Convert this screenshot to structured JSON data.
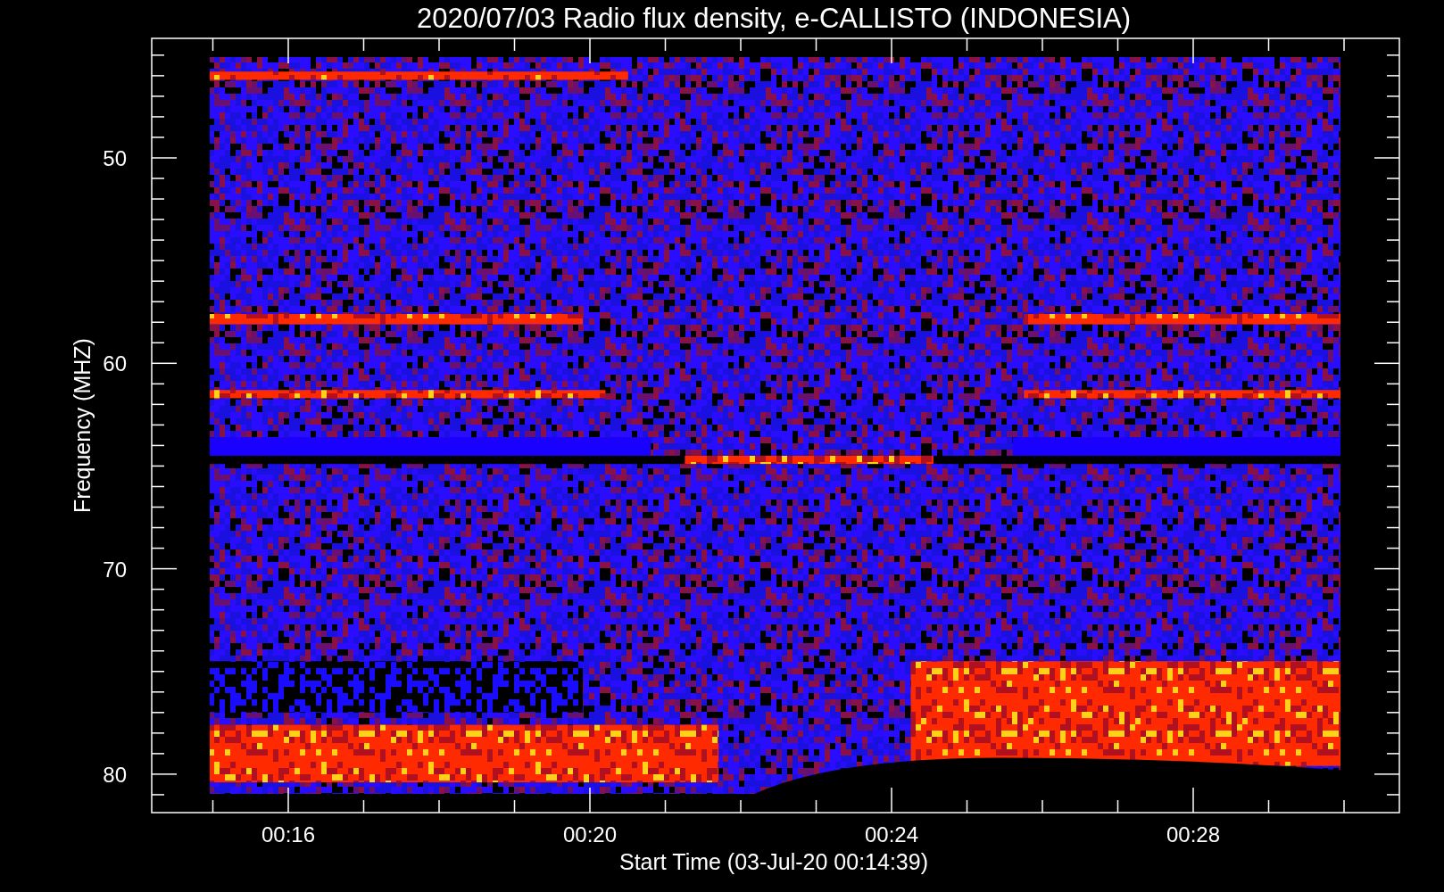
{
  "title": "2020/07/03  Radio flux density, e-CALLISTO (INDONESIA)",
  "y_axis": {
    "label": "Frequency (MHZ)",
    "ticks": [
      "50",
      "60",
      "70",
      "80"
    ]
  },
  "x_axis": {
    "label": "Start Time (03-Jul-20 00:14:39)",
    "ticks": [
      "00:16",
      "00:20",
      "00:24",
      "00:28"
    ]
  }
}
